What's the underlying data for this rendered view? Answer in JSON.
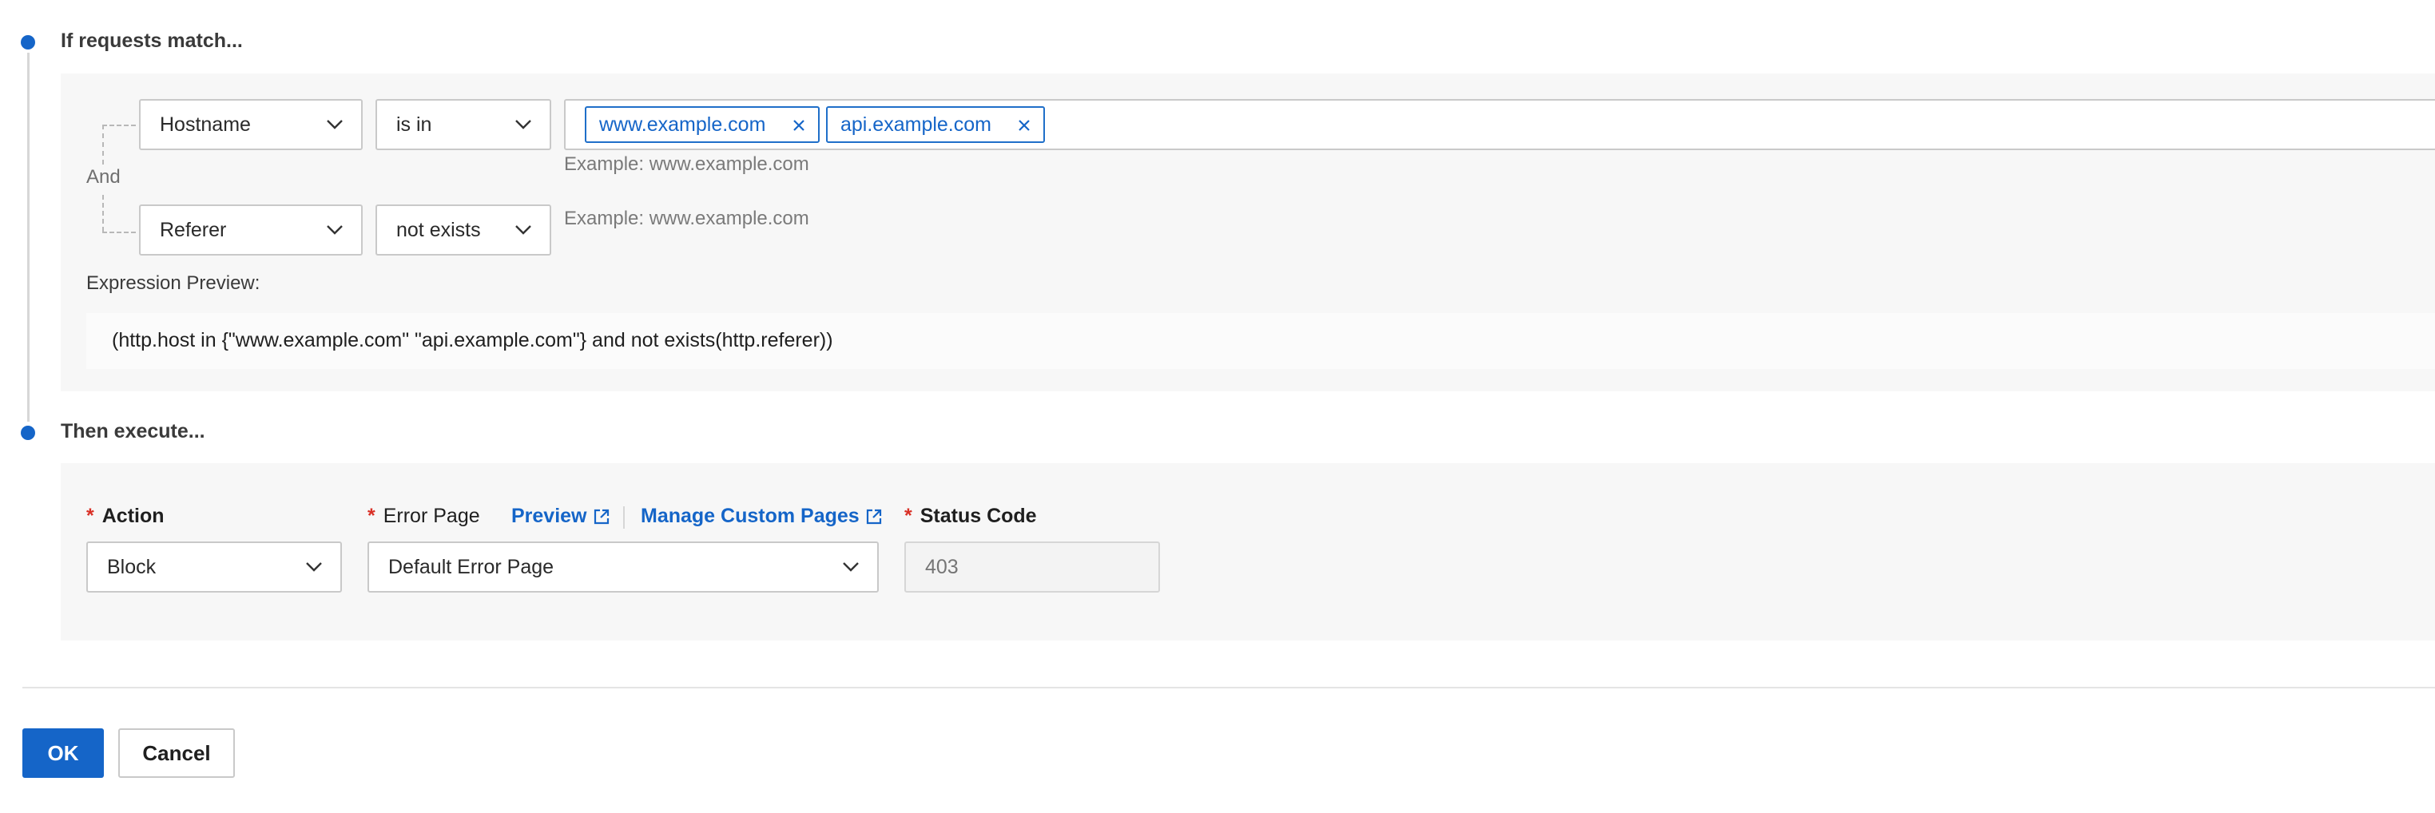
{
  "steps": {
    "match_title": "If requests match...",
    "execute_title": "Then execute..."
  },
  "conditions": {
    "logic_label": "And",
    "rows": [
      {
        "field": "Hostname",
        "operator": "is in",
        "values": [
          "www.example.com",
          "api.example.com"
        ],
        "helper": "Example: www.example.com"
      },
      {
        "field": "Referer",
        "operator": "not exists",
        "values": [],
        "helper": "Example: www.example.com"
      }
    ]
  },
  "expression": {
    "label": "Expression Preview:",
    "text": "(http.host in {\"www.example.com\" \"api.example.com\"} and not exists(http.referer))"
  },
  "execute": {
    "action": {
      "required_mark": "*",
      "label": "Action",
      "value": "Block"
    },
    "error_page": {
      "required_mark": "*",
      "label": "Error Page",
      "preview_link": "Preview",
      "manage_link": "Manage Custom Pages",
      "value": "Default Error Page"
    },
    "status_code": {
      "required_mark": "*",
      "label": "Status Code",
      "placeholder": "403"
    }
  },
  "footer": {
    "ok_label": "OK",
    "cancel_label": "Cancel"
  },
  "colors": {
    "accent": "#1565c8",
    "required": "#d93026",
    "panel_bg": "#f7f7f7"
  }
}
